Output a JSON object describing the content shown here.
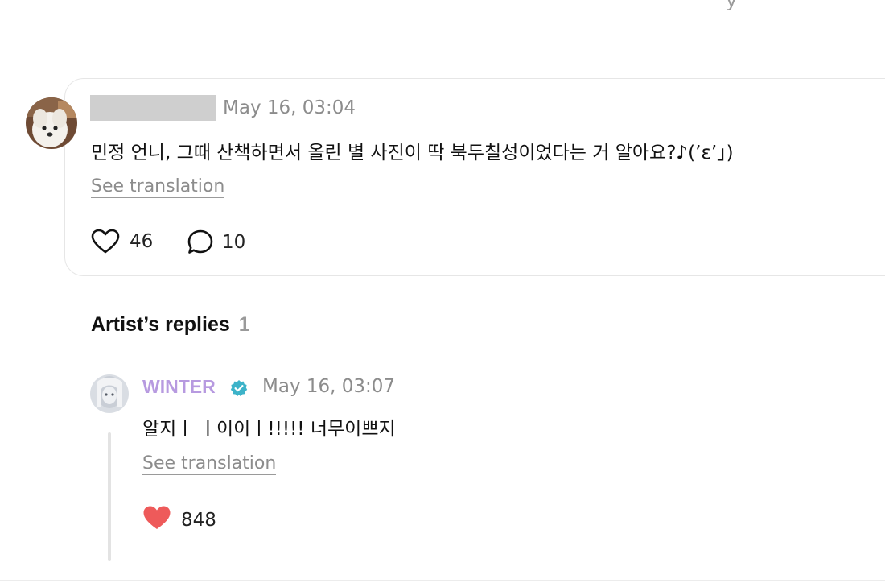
{
  "top": {
    "fragment": "y"
  },
  "comment": {
    "timestamp": "May 16, 03:04",
    "text": "민정 언니, 그때 산책하면서 올린 별 사진이 딱 북두칠성이었다는 거 알아요?♪(’ε’｣)",
    "translate_label": "See translation",
    "likes": "46",
    "replies": "10"
  },
  "artist_replies": {
    "title": "Artist’s replies",
    "count": "1"
  },
  "reply": {
    "author": "WINTER",
    "timestamp": "May 16, 03:07",
    "text": "알지ㅣ ㅣ이이ㅣ!!!!! 너무이쁘지",
    "translate_label": "See translation",
    "likes": "848"
  },
  "colors": {
    "artist_name": "#b79ae0",
    "verified": "#3db3c9",
    "liked_heart": "#ee5a5a",
    "muted_text": "#8c8c8c"
  },
  "icons": {
    "like": "heart-outline-icon",
    "reply": "speech-bubble-icon",
    "verified": "verified-badge-icon",
    "liked": "heart-filled-icon"
  }
}
